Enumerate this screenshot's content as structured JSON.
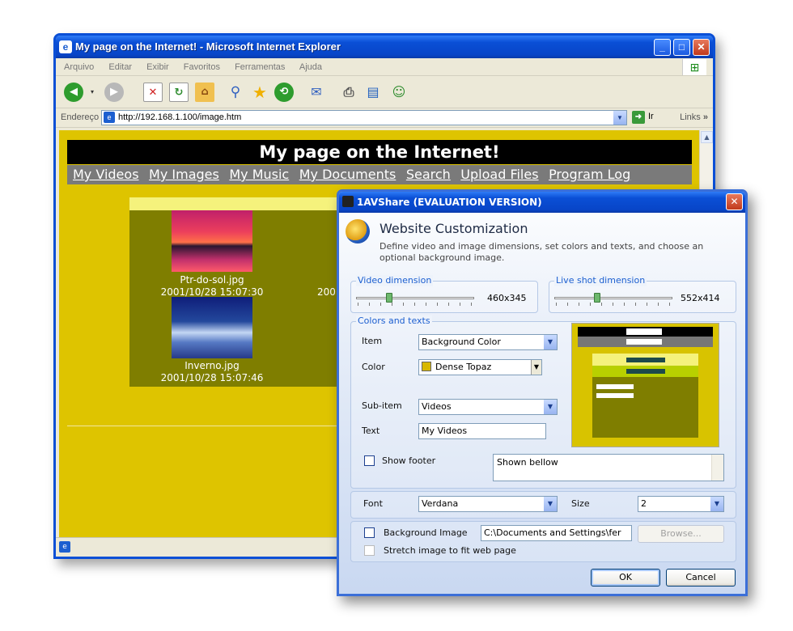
{
  "browser": {
    "title": "My page on the Internet! - Microsoft Internet Explorer",
    "menu": [
      "Arquivo",
      "Editar",
      "Exibir",
      "Favoritos",
      "Ferramentas",
      "Ajuda"
    ],
    "address_label": "Endereço",
    "address_value": "http://192.168.1.100/image.htm",
    "go_label": "Ir",
    "links_label": "Links"
  },
  "page": {
    "banner": "My page on the Internet!",
    "nav": [
      "My Videos",
      "My Images",
      "My Music",
      "My Documents",
      "Search",
      "Upload Files",
      "Program Log"
    ],
    "images": [
      {
        "name": "Ptr-do-sol.jpg",
        "date": "2001/10/28 15:07:30"
      },
      {
        "name": "Inverno.jpg",
        "date": "2001/10/28 15:07:46"
      }
    ],
    "partial_date": "200"
  },
  "dialog": {
    "title": "1AVShare (EVALUATION VERSION)",
    "heading": "Website Customization",
    "description": "Define video and image dimensions, set colors and texts, and choose an optional background image.",
    "video_group": "Video dimension",
    "video_value": "460x345",
    "video_slider_fraction": 0.25,
    "live_group": "Live shot dimension",
    "live_value": "552x414",
    "live_slider_fraction": 0.34,
    "colors_group": "Colors and texts",
    "item_label": "Item",
    "item_value": "Background Color",
    "color_label": "Color",
    "color_value": "Dense Topaz",
    "color_hex": "#d8b800",
    "subitem_label": "Sub-item",
    "subitem_value": "Videos",
    "text_label": "Text",
    "text_value": "My Videos",
    "show_footer_label": "Show footer",
    "footer_text": "Shown bellow",
    "font_label": "Font",
    "font_value": "Verdana",
    "size_label": "Size",
    "size_value": "2",
    "bg_image_label": "Background Image",
    "bg_image_path": "C:\\Documents and Settings\\fer",
    "browse_label": "Browse...",
    "stretch_label": "Stretch image to fit web page",
    "ok_label": "OK",
    "cancel_label": "Cancel"
  }
}
